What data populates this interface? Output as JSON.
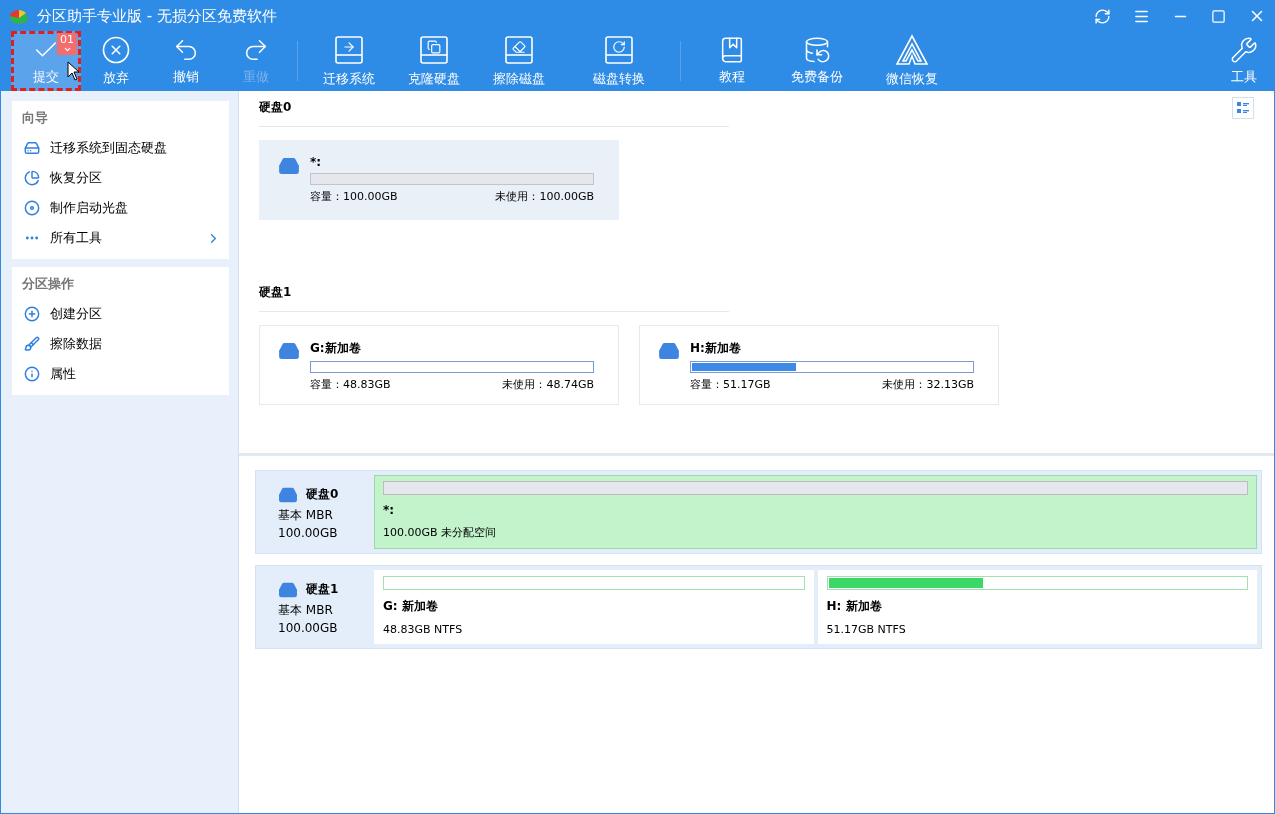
{
  "window": {
    "title": "分区助手专业版 - 无损分区免费软件"
  },
  "toolbar": {
    "buttons": [
      {
        "label": "提交",
        "kind": "check",
        "disabled": false,
        "selected": true,
        "badge": "01"
      },
      {
        "label": "放弃",
        "kind": "discard",
        "disabled": false,
        "selected": false
      },
      {
        "label": "撤销",
        "kind": "undo",
        "disabled": false,
        "selected": false
      },
      {
        "label": "重做",
        "kind": "redo",
        "disabled": true,
        "selected": false
      },
      {
        "label": "迁移系统",
        "kind": "migrate",
        "disabled": false,
        "selected": false
      },
      {
        "label": "克隆硬盘",
        "kind": "clone",
        "disabled": false,
        "selected": false
      },
      {
        "label": "擦除磁盘",
        "kind": "erase",
        "disabled": false,
        "selected": false
      },
      {
        "label": "磁盘转换",
        "kind": "convert",
        "disabled": false,
        "selected": false
      },
      {
        "label": "教程",
        "kind": "book",
        "disabled": false,
        "selected": false
      },
      {
        "label": "免费备份",
        "kind": "backup",
        "disabled": false,
        "selected": false
      },
      {
        "label": "微信恢复",
        "kind": "recover",
        "disabled": false,
        "selected": false
      }
    ],
    "tools": {
      "label": "工具"
    }
  },
  "sidebar": {
    "sections": [
      {
        "title": "向导",
        "items": [
          {
            "label": "迁移系统到固态硬盘",
            "kind": "migrate",
            "submenu": false
          },
          {
            "label": "恢复分区",
            "kind": "restore",
            "submenu": false
          },
          {
            "label": "制作启动光盘",
            "kind": "bootdisk",
            "submenu": false
          },
          {
            "label": "所有工具",
            "kind": "more",
            "submenu": true
          }
        ]
      },
      {
        "title": "分区操作",
        "items": [
          {
            "label": "创建分区",
            "kind": "create",
            "submenu": false
          },
          {
            "label": "擦除数据",
            "kind": "wipe",
            "submenu": false
          },
          {
            "label": "属性",
            "kind": "info",
            "submenu": false
          }
        ]
      }
    ]
  },
  "disks": [
    {
      "name": "硬盘0",
      "partitions": [
        {
          "label": "*:",
          "kind": "unallocated",
          "capacity": "容量：100.00GB",
          "free": "未使用：100.00GB",
          "selected": true
        }
      ]
    },
    {
      "name": "硬盘1",
      "partitions": [
        {
          "label": "G:新加卷",
          "kind": "volume",
          "capacity": "容量：48.83GB",
          "free": "未使用：48.74GB",
          "selected": false
        },
        {
          "label": "H:新加卷",
          "kind": "volume",
          "capacity": "容量：51.17GB",
          "free": "未使用：32.13GB",
          "level": 0.37,
          "selected": false
        }
      ]
    }
  ],
  "disk_map": [
    {
      "name": "硬盘0",
      "type": "基本 MBR",
      "size": "100.00GB",
      "partitions": [
        {
          "label": "*:",
          "info": "100.00GB 未分配空间",
          "kind": "unallocated"
        }
      ]
    },
    {
      "name": "硬盘1",
      "type": "基本 MBR",
      "size": "100.00GB",
      "partitions": [
        {
          "label": "G: 新加卷",
          "info": "48.83GB NTFS",
          "kind": "volume"
        },
        {
          "label": "H: 新加卷",
          "info": "51.17GB NTFS",
          "kind": "volume",
          "level": 0.37
        }
      ]
    }
  ]
}
